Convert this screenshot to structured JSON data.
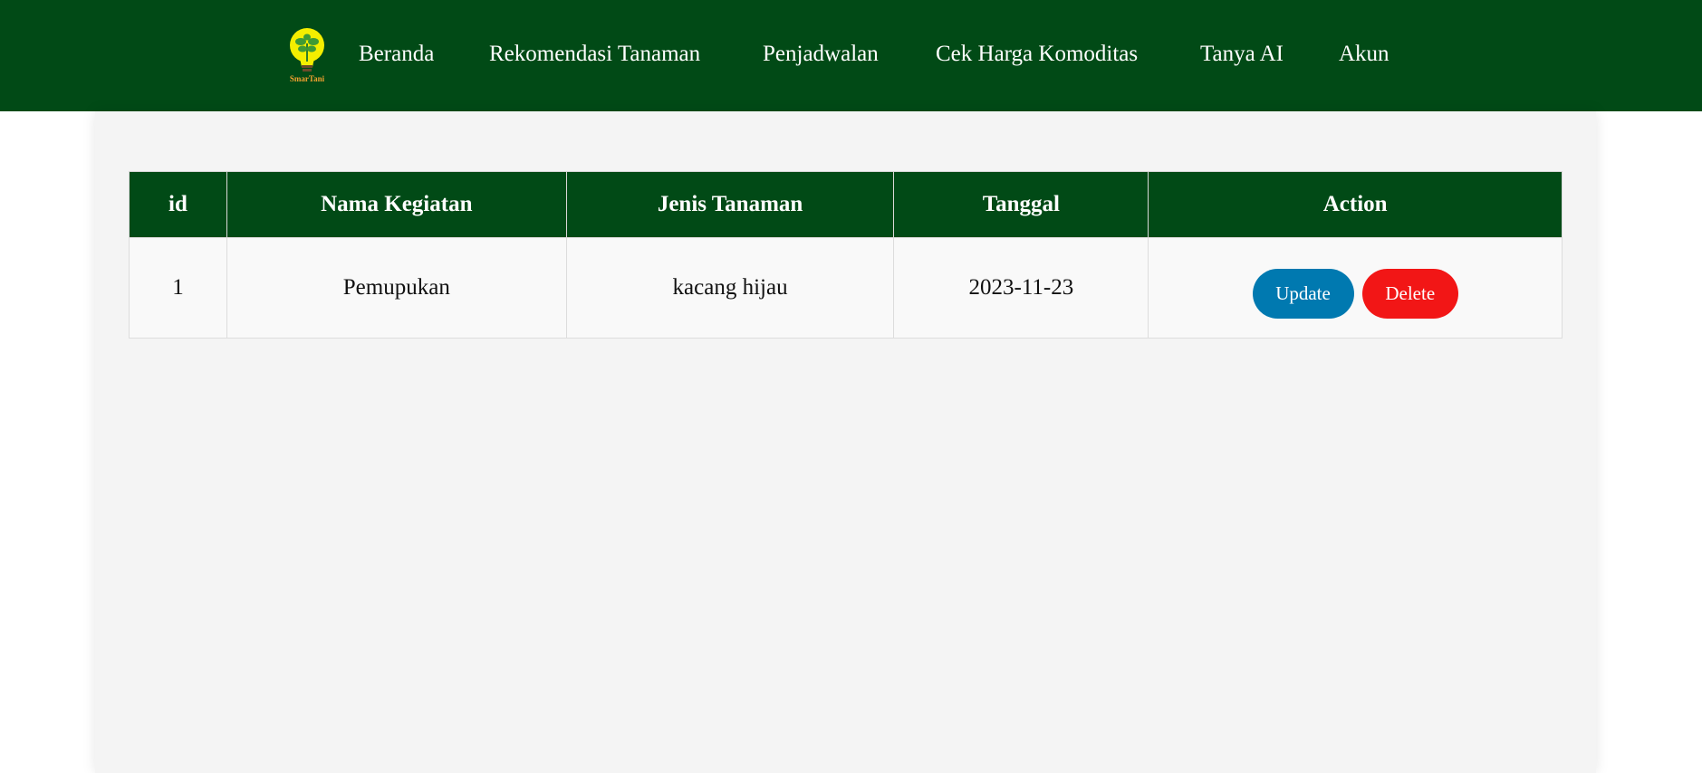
{
  "header": {
    "logo_text": "SmarTani",
    "nav": [
      "Beranda",
      "Rekomendasi Tanaman",
      "Penjadwalan",
      "Cek Harga Komoditas",
      "Tanya AI",
      "Akun"
    ]
  },
  "table": {
    "columns": [
      "id",
      "Nama Kegiatan",
      "Jenis Tanaman",
      "Tanggal",
      "Action"
    ],
    "rows": [
      {
        "id": "1",
        "nama_kegiatan": "Pemupukan",
        "jenis_tanaman": "kacang hijau",
        "tanggal": "2023-11-23"
      }
    ],
    "actions": {
      "update_label": "Update",
      "delete_label": "Delete"
    }
  },
  "colors": {
    "header_bg": "#014a16",
    "update_button": "#0079b0",
    "delete_button": "#f21616",
    "panel_bg": "#f4f4f4"
  }
}
